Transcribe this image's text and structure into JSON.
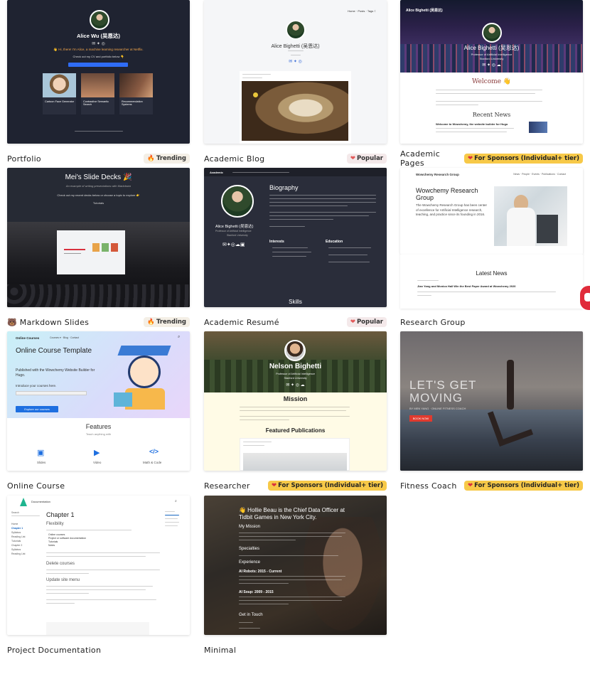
{
  "cards": [
    {
      "title": "Portfolio",
      "badge": "Trending",
      "badge_icon": "fire-icon",
      "preview": {
        "name": "Alice Wu (吴恩达)",
        "intro": "👋 Hi, there! I'm Alice, a machine learning researcher at Netflix.",
        "cta": "Check out my CV and portfolio below 👇",
        "projects": [
          "Cartoon Face Generator",
          "Contrastive Semantic Search",
          "Recommendation Systems"
        ]
      }
    },
    {
      "title": "Academic Blog",
      "badge": "Popular",
      "badge_icon": "heart-icon",
      "preview": {
        "name": "Alice Bighetti (吴恩达)",
        "nav": [
          "Home",
          "Posts",
          "Tags"
        ]
      }
    },
    {
      "title": "Academic Pages",
      "badge": "For Sponsors (Individual+ tier)",
      "badge_icon": "heart-icon",
      "preview": {
        "name": "Alice Bighetti (吴恩达)",
        "role": "Professor of Artificial Intelligence",
        "org": "Stanford University",
        "welcome": "Welcome 👋",
        "recent_news": "Recent News",
        "news_title": "Welcome to Wowchemy, the website builder for Hugo"
      }
    },
    {
      "title": "Markdown Slides",
      "title_icon": "bear-icon",
      "badge": "Trending",
      "badge_icon": "fire-icon",
      "preview": {
        "heading": "Mei's Slide Decks 🎉",
        "sub": "An example of writing presentations with Markdown",
        "cta": "Check out my recent decks below or choose a topic to explore 👉",
        "tab": "Tutorials"
      }
    },
    {
      "title": "Academic Resumé",
      "badge": "Popular",
      "badge_icon": "heart-icon",
      "preview": {
        "heading": "Biography",
        "name": "Alice Bighetti (吴恩达)",
        "role": "Professor of Artificial Intelligence",
        "org": "Stanford University",
        "interests": "Interests",
        "education": "Education",
        "skills": "Skills"
      }
    },
    {
      "title": "Research Group",
      "preview": {
        "brand": "Wowchemy Research Group",
        "heading": "Wowchemy Research Group",
        "body": "The Wowchemy Research Group has been center of excellence for Artificial Intelligence research, teaching, and practice since its founding in 2016.",
        "latest_news": "Latest News",
        "news_title": "Jian Yang and Monica Hall Win the Best Paper Award at Wowchemy 2020"
      }
    },
    {
      "title": "Online Course",
      "preview": {
        "brand": "Online Courses",
        "heading": "Online Course Template",
        "published": "Published with the Wowchemy Website Builder for Hugo.",
        "intro": "Introduce your courses here.",
        "cta": "Explore our courses",
        "features": "Features",
        "features_sub": "Teach anything with",
        "items": [
          "Slides",
          "Video",
          "Math & Code"
        ]
      }
    },
    {
      "title": "Researcher",
      "badge": "For Sponsors (Individual+ tier)",
      "badge_icon": "heart-icon",
      "preview": {
        "name": "Nelson Bighetti",
        "role": "Professor of Artificial Intelligence",
        "org": "Stanford University",
        "mission": "Mission",
        "featured": "Featured Publications"
      }
    },
    {
      "title": "Fitness Coach",
      "badge": "For Sponsors (Individual+ tier)",
      "badge_icon": "heart-icon",
      "preview": {
        "heading_1": "LET'S GET",
        "heading_2": "MOVING",
        "sub": "BY MEN YANG · ONLINE FITNESS COACH",
        "cta": "BOOK NOW"
      }
    },
    {
      "title": "Project Documentation",
      "preview": {
        "brand": "Documentation",
        "heading": "Chapter 1",
        "section": "Flexibility",
        "delete": "Delete courses",
        "update": "Update site menu",
        "sidebar": [
          "Home",
          "Chapter 1",
          "Syllabus",
          "Reading List",
          "Tutorials",
          "Chapter 2",
          "Syllabus",
          "Reading List"
        ],
        "bullets": [
          "Online courses",
          "Project or software documentation",
          "Tutorials",
          "Notes"
        ]
      }
    },
    {
      "title": "Minimal",
      "preview": {
        "heading": "👋 Hollie Beau is the Chief Data Officer at Tidbit Games in New York City.",
        "mission": "My Mission",
        "specialties": "Specialties",
        "experience": "Experience",
        "job_1": "AI Robots: 2015 - Current",
        "job_2": "AI Soup: 2009 - 2015",
        "contact": "Get in Touch"
      }
    }
  ],
  "colors": {
    "sponsor": "#f7c948",
    "dark_bg": "#20232f",
    "accent_blue": "#1565c0"
  }
}
